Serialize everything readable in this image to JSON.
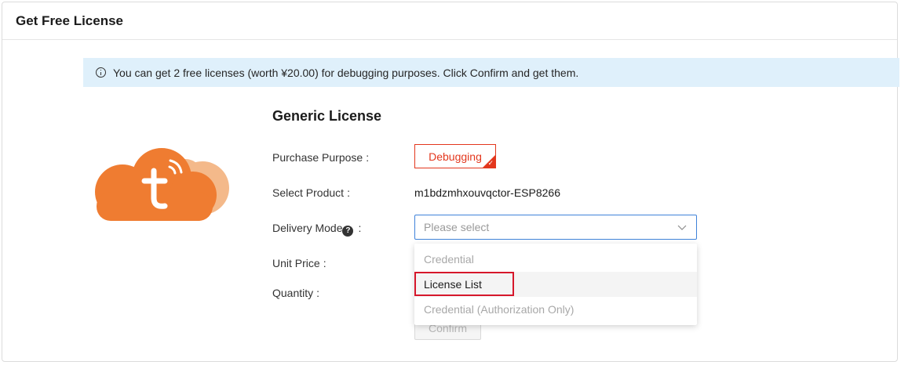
{
  "header": {
    "title": "Get Free License"
  },
  "alert": {
    "icon": "info-icon",
    "text": "You can get 2 free licenses (worth ¥20.00) for debugging purposes. Click Confirm and get them."
  },
  "logo": {
    "icon": "cloud-t-logo",
    "colors": {
      "cloud": "#ef7c31",
      "cloud_back": "#f4b98a"
    }
  },
  "form": {
    "title": "Generic License",
    "purchase_purpose_label": "Purchase Purpose",
    "purchase_purpose_value": "Debugging",
    "select_product_label": "Select Product",
    "select_product_value": "m1bdzmhxouvqctor-ESP8266",
    "delivery_mode_label": "Delivery Mode",
    "help_glyph": "?",
    "delivery_mode_placeholder": "Please select",
    "unit_price_label": "Unit Price",
    "quantity_label": "Quantity",
    "label_suffix": ":",
    "confirm_label": "Confirm"
  },
  "dropdown": {
    "options": [
      {
        "label": "Credential"
      },
      {
        "label": "License List"
      },
      {
        "label": "Credential (Authorization Only)"
      }
    ]
  },
  "colors": {
    "accent": "#e3371d",
    "focus": "#3f82d9",
    "highlight": "#d6172b",
    "alert_bg": "#dff0fb"
  }
}
